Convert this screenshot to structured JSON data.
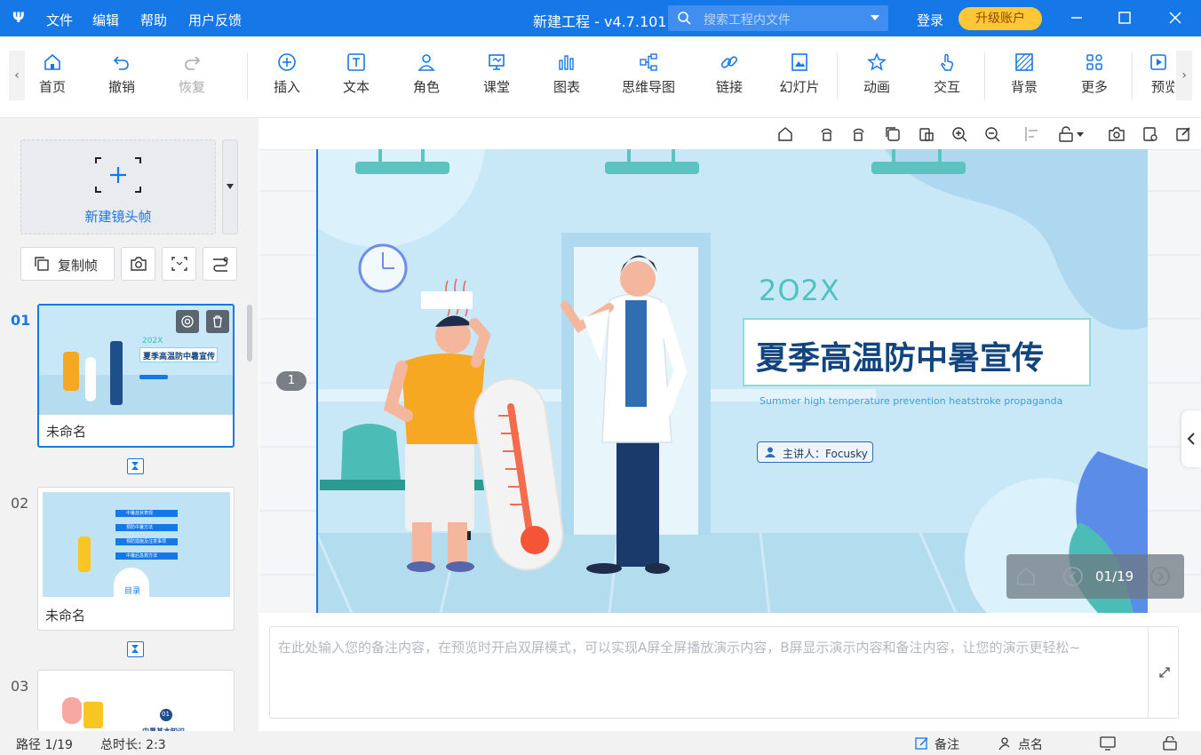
{
  "titlebar": {
    "logo": "Ψ",
    "menu": [
      "文件",
      "编辑",
      "帮助",
      "用户反馈"
    ],
    "title": "新建工程 - v4.7.101",
    "search_placeholder": "搜索工程内文件",
    "login": "登录",
    "upgrade": "升级账户"
  },
  "toolbar": {
    "home": "首页",
    "undo": "撤销",
    "redo": "恢复",
    "insert": "插入",
    "text": "文本",
    "role": "角色",
    "class": "课堂",
    "chart": "图表",
    "mindmap": "思维导图",
    "link": "链接",
    "slides": "幻灯片",
    "animation": "动画",
    "interact": "交互",
    "background": "背景",
    "more": "更多",
    "preview": "预览"
  },
  "left": {
    "new_frame": "新建镜头帧",
    "copy_frame": "复制帧",
    "slides": [
      {
        "num": "01",
        "name": "未命名"
      },
      {
        "num": "02",
        "name": "未命名"
      },
      {
        "num": "03",
        "name": ""
      }
    ],
    "thumb1": {
      "year": "202X",
      "title": "夏季高温防中暑宣传"
    },
    "thumb2": {
      "items": [
        "中暑症状表现",
        "预防中暑方法",
        "预防措施及注意事项",
        "中暑后急救方法"
      ],
      "label": "目录"
    },
    "thumb3": {
      "num": "01",
      "title": "中暑基本知识"
    }
  },
  "canvas": {
    "path_marker": "1",
    "slide": {
      "year": "2O2X",
      "title": "夏季高温防中暑宣传",
      "subtitle": "Summer high temperature prevention heatstroke propaganda",
      "speaker": "主讲人：Focusky"
    },
    "pager": "01/19"
  },
  "notes": {
    "placeholder": "在此处输入您的备注内容，在预览时开启双屏模式，可以实现A屏全屏播放演示内容，B屏显示演示内容和备注内容，让您的演示更轻松~"
  },
  "status": {
    "path": "路径 1/19",
    "duration": "总时长: 2:3",
    "notes_btn": "备注",
    "rollcall_btn": "点名"
  },
  "colors": {
    "brand": "#1677e6",
    "upgrade": "#ffc735",
    "slide_bg": "#c9e8f7"
  }
}
